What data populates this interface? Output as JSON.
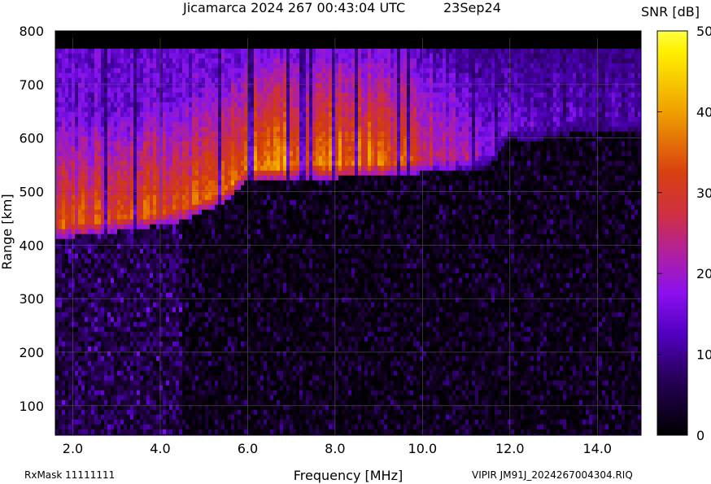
{
  "header": {
    "title": "Jicamarca 2024 267 00:43:04 UTC",
    "date": "23Sep24"
  },
  "colorbar": {
    "title": "SNR [dB]",
    "ticks": [
      "50",
      "40",
      "30",
      "20",
      "10",
      "0"
    ]
  },
  "footer": {
    "rxmask": "RxMask 11111111",
    "file": "VIPIR  JM91J_2024267004304.RIQ"
  },
  "chart_data": {
    "type": "heatmap",
    "title": "Jicamarca 2024 267 00:43:04 UTC",
    "xlabel": "Frequency [MHz]",
    "ylabel": "Range [km]",
    "xlim": [
      1.6,
      15.0
    ],
    "ylim": [
      45,
      800
    ],
    "x_ticks": [
      "2.0",
      "4.0",
      "6.0",
      "8.0",
      "10.0",
      "12.0",
      "14.0"
    ],
    "y_ticks": [
      "100",
      "200",
      "300",
      "400",
      "500",
      "600",
      "700",
      "800"
    ],
    "colorscale": {
      "label": "SNR [dB]",
      "range": [
        0,
        50
      ],
      "colors": [
        "#000000",
        "#3a0080",
        "#8000ff",
        "#d03060",
        "#e06000",
        "#ffe000",
        "#ffff00"
      ]
    },
    "data_top_range_km": 767,
    "echo_trace": {
      "description_frequency_mhz": [
        1.6,
        2.5,
        3.5,
        4.5,
        5.5,
        6.0,
        7.0,
        8.0,
        9.0,
        10.0,
        11.0,
        11.5,
        12.0,
        12.5,
        13.5,
        15.0
      ],
      "lower_edge_range_km": [
        412,
        420,
        430,
        445,
        480,
        520,
        525,
        525,
        530,
        535,
        540,
        545,
        600,
        595,
        615,
        615
      ],
      "peak_snr_db": [
        28,
        30,
        30,
        30,
        32,
        35,
        36,
        35,
        33,
        25,
        18,
        14,
        12,
        12,
        11,
        10
      ]
    }
  }
}
